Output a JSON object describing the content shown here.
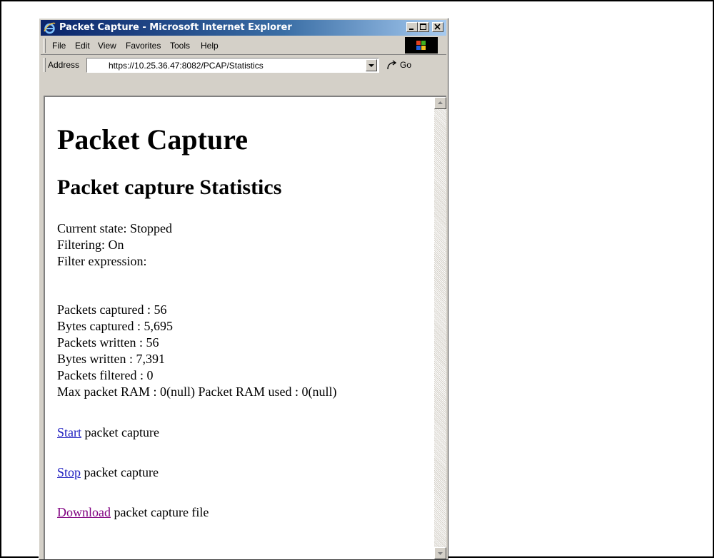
{
  "window": {
    "title": "Packet Capture - Microsoft Internet Explorer"
  },
  "menu": {
    "items": [
      "File",
      "Edit",
      "View",
      "Favorites",
      "Tools",
      "Help"
    ]
  },
  "address": {
    "label": "Address",
    "url": "https://10.25.36.47:8082/PCAP/Statistics",
    "go_label": "Go"
  },
  "page": {
    "heading": "Packet Capture",
    "subheading": "Packet capture Statistics",
    "status_lines": [
      "Current state: Stopped",
      "Filtering: On",
      "Filter expression:"
    ],
    "stats_lines": [
      "Packets captured : 56",
      "Bytes captured : 5,695",
      "Packets written : 56",
      "Bytes written : 7,391",
      "Packets filtered : 0",
      "Max packet RAM : 0(null) Packet RAM used : 0(null)"
    ],
    "actions": [
      {
        "link": "Start",
        "text": " packet capture"
      },
      {
        "link": "Stop",
        "text": " packet capture"
      },
      {
        "link": "Download",
        "text": " packet capture file"
      }
    ]
  },
  "colors": {
    "link": "#2020c0",
    "visited_link": "#800080",
    "titlebar_start": "#0a246a",
    "titlebar_end": "#a6caf0",
    "chrome": "#d4d0c8"
  }
}
